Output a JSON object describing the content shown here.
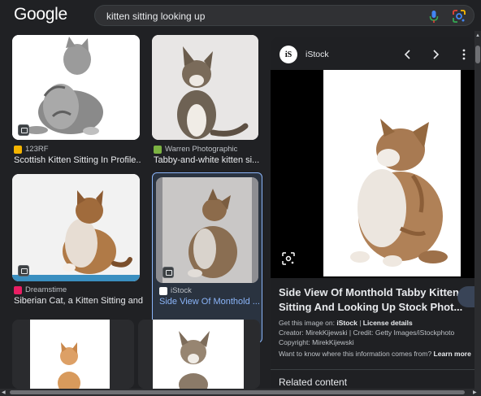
{
  "header": {
    "logo_text": "Google",
    "search_value": "kitten sitting looking up"
  },
  "results": [
    {
      "source": "123RF",
      "title": "Scottish Kitten Sitting In Profile...",
      "favicon_color": "#f4b400"
    },
    {
      "source": "Warren Photographic",
      "title": "Tabby-and-white kitten si...",
      "favicon_color": "#7cb342"
    },
    {
      "source": "Dreamstime",
      "title": "Siberian Cat, a Kitten Sitting and ...",
      "favicon_color": "#e91e63"
    },
    {
      "source": "iStock",
      "title": "Side View Of Monthold ...",
      "favicon_color": "#ffffff"
    },
    {
      "source": "",
      "title": "",
      "favicon_color": ""
    },
    {
      "source": "",
      "title": "",
      "favicon_color": ""
    }
  ],
  "panel": {
    "source_name": "iStock",
    "logo_text": "iS",
    "prev_icon": "chevron-left-icon",
    "next_icon": "chevron-right-icon",
    "more_icon": "more-vert-icon",
    "title": "Side View Of Monthold Tabby Kitten Sitting And Looking Up Stock Phot...",
    "get_image_prefix": "Get this image on: ",
    "get_image_site": "iStock",
    "get_image_sep": " | ",
    "license_details": "License details",
    "creator_line": "Creator: MirekKijewski | Credit: Getty Images/iStockphoto",
    "copyright_line": "Copyright: MirekKijewski",
    "info_question": "Want to know where this information comes from? ",
    "learn_more": "Learn more",
    "related": "Related content"
  },
  "colors": {
    "background": "#202124",
    "accent": "#8ab4f8"
  }
}
